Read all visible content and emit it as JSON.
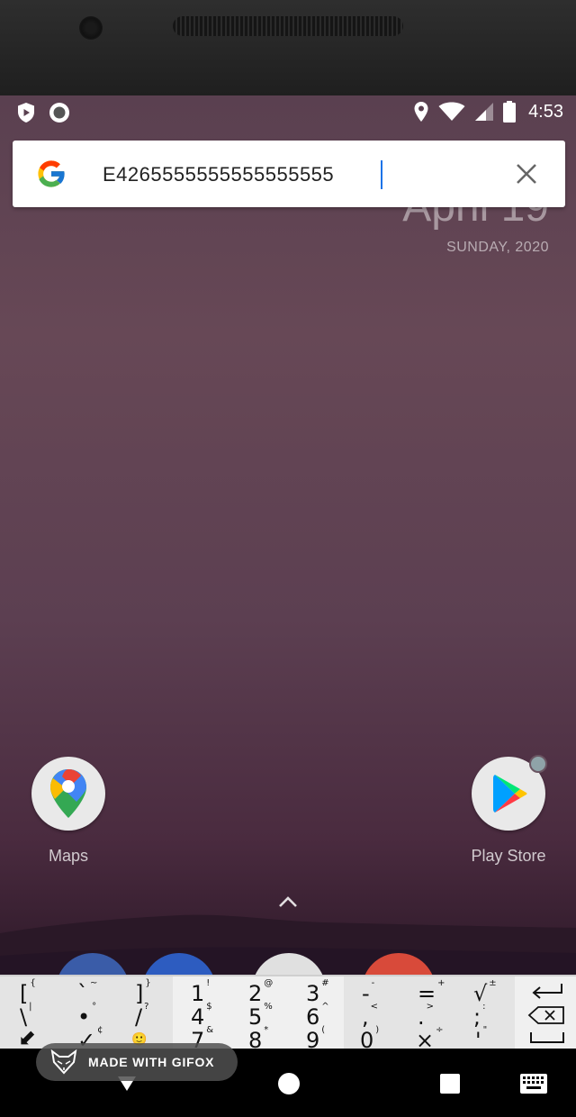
{
  "status_bar": {
    "time": "4:53",
    "icons_left": [
      "play-protect-icon",
      "record-icon"
    ],
    "icons_right": [
      "location-icon",
      "wifi-icon",
      "signal-icon",
      "battery-icon"
    ]
  },
  "date_widget": {
    "date": "April 19",
    "day": "SUNDAY, 2020"
  },
  "search": {
    "value": "E4265555555555555555",
    "placeholder": "",
    "logo": "google-logo",
    "clear_icon": "close-icon"
  },
  "apps": [
    {
      "label": "Maps",
      "icon": "maps-icon"
    },
    {
      "label": "Play Store",
      "icon": "play-store-icon"
    }
  ],
  "keyboard": {
    "group1": [
      {
        "main": "[",
        "alt": "{"
      },
      {
        "main": "`",
        "alt": "~"
      },
      {
        "main": "]",
        "alt": "}"
      },
      {
        "main": "\\",
        "alt": "|"
      },
      {
        "main": "•",
        "alt": "°"
      },
      {
        "main": "/",
        "alt": "?"
      },
      {
        "main": "⬋",
        "alt": ""
      },
      {
        "main": "✓",
        "alt": "¢"
      },
      {
        "main": "🙂",
        "alt": ""
      }
    ],
    "group2": [
      {
        "main": "1",
        "alt": "!"
      },
      {
        "main": "2",
        "alt": "@"
      },
      {
        "main": "3",
        "alt": "#"
      },
      {
        "main": "4",
        "alt": "$"
      },
      {
        "main": "5",
        "alt": "%"
      },
      {
        "main": "6",
        "alt": "^"
      },
      {
        "main": "7",
        "alt": "&"
      },
      {
        "main": "8",
        "alt": "*"
      },
      {
        "main": "9",
        "alt": "("
      }
    ],
    "group3": [
      {
        "main": "-",
        "alt": "-"
      },
      {
        "main": "=",
        "alt": "+"
      },
      {
        "main": "√",
        "alt": "±"
      },
      {
        "main": ",",
        "alt": "<"
      },
      {
        "main": ".",
        "alt": ">"
      },
      {
        "main": ";",
        "alt": ":"
      },
      {
        "main": "0",
        "alt": ")"
      },
      {
        "main": "×",
        "alt": "÷"
      },
      {
        "main": "'",
        "alt": "\""
      }
    ]
  },
  "watermark": {
    "text": "MADE WITH GIFOX"
  }
}
